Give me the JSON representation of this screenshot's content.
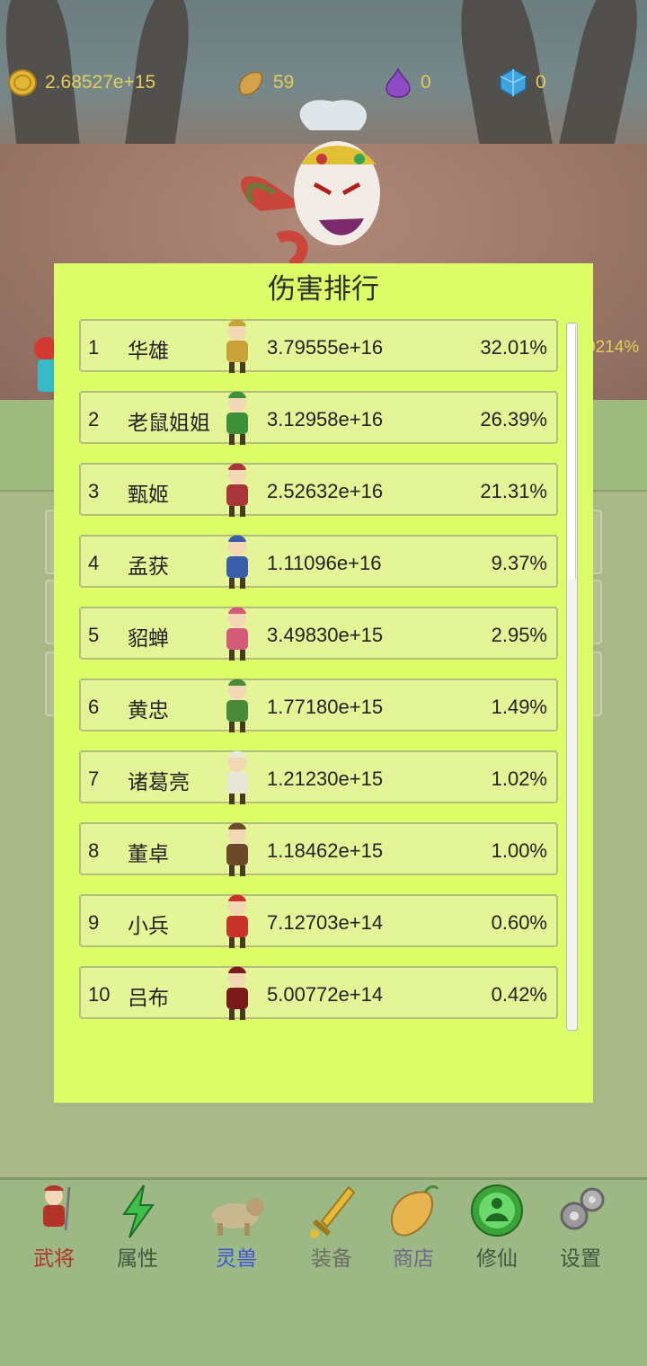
{
  "resources": [
    {
      "icon": "gold-coin-icon",
      "value": "2.68527e+15",
      "color": "#e3b534"
    },
    {
      "icon": "mango-icon",
      "value": "59",
      "color": "#d4a24a"
    },
    {
      "icon": "purple-potion-icon",
      "value": "0",
      "color": "#8f4bc4"
    },
    {
      "icon": "blue-gem-icon",
      "value": "0",
      "color": "#3fa3df"
    }
  ],
  "battle": {
    "hp_percent_text": "0214%"
  },
  "dialog": {
    "title": "伤害排行",
    "rows": [
      {
        "rank": "1",
        "name": "华雄",
        "damage": "3.79555e+16",
        "percent": "32.01%"
      },
      {
        "rank": "2",
        "name": "老鼠姐姐",
        "damage": "3.12958e+16",
        "percent": "26.39%"
      },
      {
        "rank": "3",
        "name": "甄姬",
        "damage": "2.52632e+16",
        "percent": "21.31%"
      },
      {
        "rank": "4",
        "name": "孟获",
        "damage": "1.11096e+16",
        "percent": "9.37%"
      },
      {
        "rank": "5",
        "name": "貂蝉",
        "damage": "3.49830e+15",
        "percent": "2.95%"
      },
      {
        "rank": "6",
        "name": "黄忠",
        "damage": "1.77180e+15",
        "percent": "1.49%"
      },
      {
        "rank": "7",
        "name": "诸葛亮",
        "damage": "1.21230e+15",
        "percent": "1.02%"
      },
      {
        "rank": "8",
        "name": "董卓",
        "damage": "1.18462e+15",
        "percent": "1.00%"
      },
      {
        "rank": "9",
        "name": "小兵",
        "damage": "7.12703e+14",
        "percent": "0.60%"
      },
      {
        "rank": "10",
        "name": "吕布",
        "damage": "5.00772e+14",
        "percent": "0.42%"
      }
    ]
  },
  "nav": [
    {
      "label": "武将",
      "icon": "general-icon",
      "color": "#b5342a"
    },
    {
      "label": "属性",
      "icon": "lightning-icon",
      "color": "#3c5a3c"
    },
    {
      "label": "灵兽",
      "icon": "beast-icon",
      "color": "#3d55d6"
    },
    {
      "label": "装备",
      "icon": "sword-icon",
      "color": "#6b6f63"
    },
    {
      "label": "商店",
      "icon": "shop-mango-icon",
      "color": "#6f6a8a"
    },
    {
      "label": "修仙",
      "icon": "cultivation-icon",
      "color": "#3c5a3c"
    },
    {
      "label": "设置",
      "icon": "gear-icon",
      "color": "#3c5a3c"
    }
  ]
}
